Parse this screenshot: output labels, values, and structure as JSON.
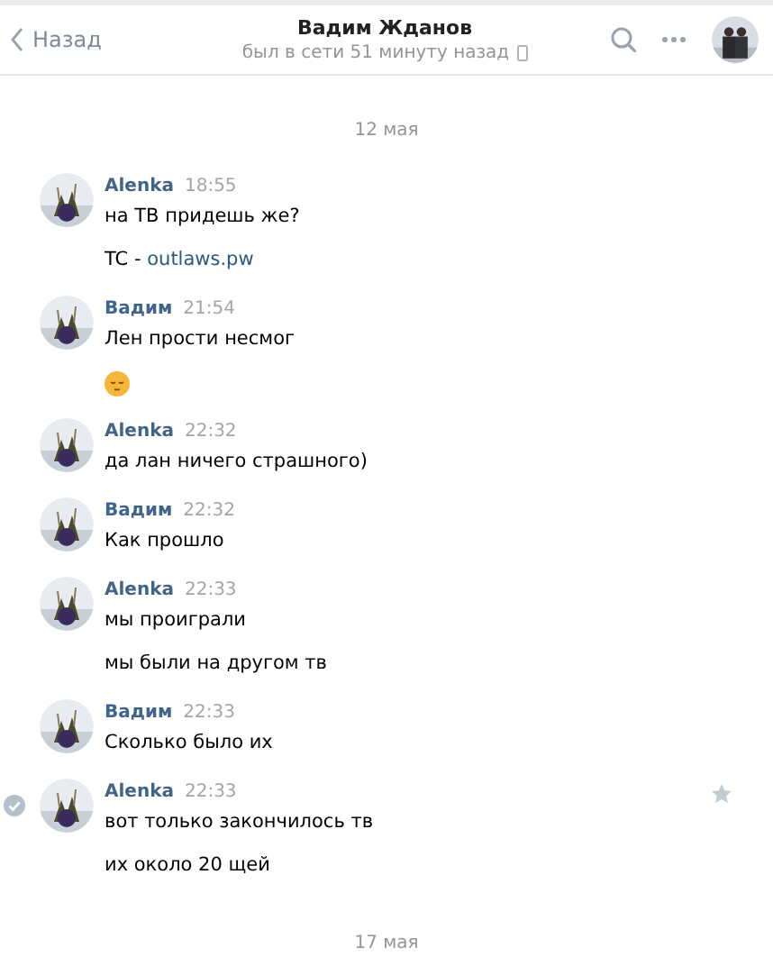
{
  "header": {
    "back": "Назад",
    "title": "Вадим Жданов",
    "status": "был в сети 51 минуту назад"
  },
  "feed": [
    {
      "kind": "date",
      "text": "12 мая"
    },
    {
      "kind": "message",
      "author": "Alenka",
      "time": "18:55",
      "selected": false,
      "paragraphs": [
        {
          "kind": "text",
          "text": "на ТВ придешь же?"
        },
        {
          "kind": "link",
          "text": "TC - ",
          "link": "outlaws.pw"
        }
      ]
    },
    {
      "kind": "message",
      "author": "Вадим",
      "time": "21:54",
      "selected": false,
      "paragraphs": [
        {
          "kind": "text",
          "text": "Лен прости несмог"
        },
        {
          "kind": "emoji"
        }
      ]
    },
    {
      "kind": "message",
      "author": "Alenka",
      "time": "22:32",
      "selected": false,
      "paragraphs": [
        {
          "kind": "text",
          "text": "да лан ничего страшного)"
        }
      ]
    },
    {
      "kind": "message",
      "author": "Вадим",
      "time": "22:32",
      "selected": false,
      "paragraphs": [
        {
          "kind": "text",
          "text": "Как прошло"
        }
      ]
    },
    {
      "kind": "message",
      "author": "Alenka",
      "time": "22:33",
      "selected": false,
      "paragraphs": [
        {
          "kind": "text",
          "text": "мы проиграли"
        },
        {
          "kind": "text",
          "text": "мы были на другом тв"
        }
      ]
    },
    {
      "kind": "message",
      "author": "Вадим",
      "time": "22:33",
      "selected": false,
      "paragraphs": [
        {
          "kind": "text",
          "text": "Сколько было их"
        }
      ]
    },
    {
      "kind": "message",
      "author": "Alenka",
      "time": "22:33",
      "selected": true,
      "paragraphs": [
        {
          "kind": "text",
          "text": "вот только закончилось тв"
        },
        {
          "kind": "text",
          "text": "их около 20 щей"
        }
      ]
    },
    {
      "kind": "date",
      "text": "17 мая"
    }
  ]
}
